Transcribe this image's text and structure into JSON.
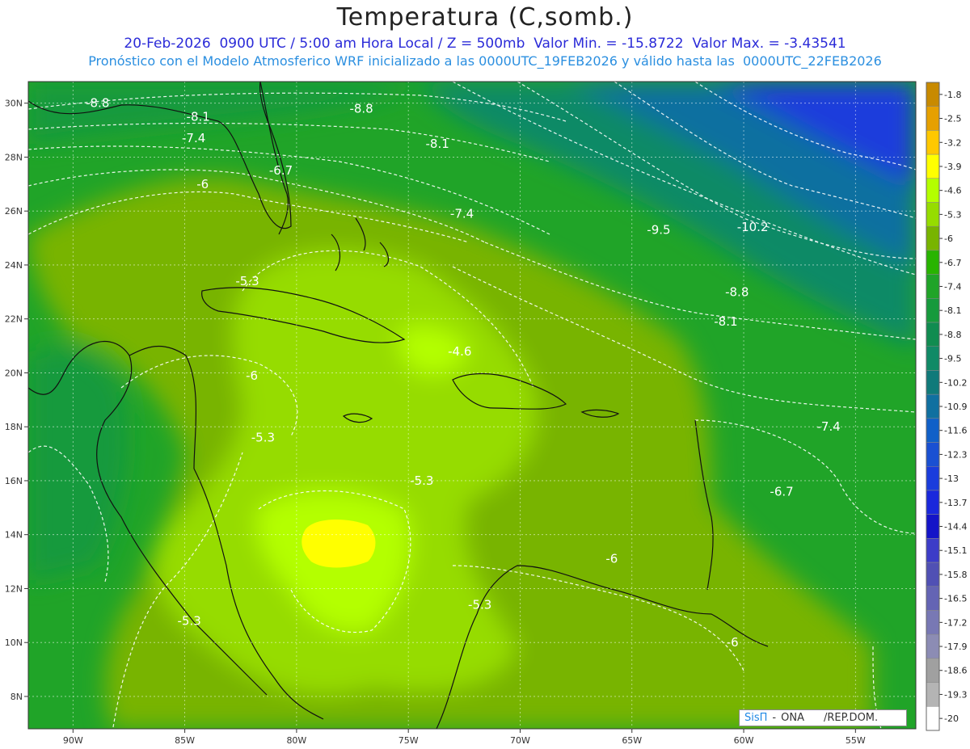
{
  "title": "Temperatura (C,somb.)",
  "subtitle_1": "20-Feb-2026  0900 UTC / 5:00 am Hora Local / Z = 500mb  Valor Min. = -15.8722  Valor Max. = -3.43541",
  "subtitle_2": "Pronóstico con el Modelo Atmosferico WRF inicializado a las 0000UTC_19FEB2026 y válido hasta las  0000UTC_22FEB2026",
  "lat_ticks": [
    "30N",
    "28N",
    "26N",
    "24N",
    "22N",
    "20N",
    "18N",
    "16N",
    "14N",
    "12N",
    "10N",
    "8N"
  ],
  "lon_ticks": [
    "90W",
    "85W",
    "80W",
    "75W",
    "70W",
    "65W",
    "60W",
    "55W"
  ],
  "legend": {
    "labels": [
      "-1.8",
      "-2.5",
      "-3.2",
      "-3.9",
      "-4.6",
      "-5.3",
      "-6",
      "-6.7",
      "-7.4",
      "-8.1",
      "-8.8",
      "-9.5",
      "-10.2",
      "-10.9",
      "-11.6",
      "-12.3",
      "-13",
      "-13.7",
      "-14.4",
      "-15.1",
      "-15.8",
      "-16.5",
      "-17.2",
      "-17.9",
      "-18.6",
      "-19.3",
      "-20"
    ],
    "colors": [
      "#c88a00",
      "#e6a000",
      "#ffc800",
      "#ffff00",
      "#b4ff00",
      "#96dc00",
      "#78b400",
      "#28b400",
      "#20a428",
      "#169a3c",
      "#108c50",
      "#108a66",
      "#107a7a",
      "#1070a0",
      "#1060c8",
      "#1a50d2",
      "#1a3cdc",
      "#1a28dc",
      "#1414c8",
      "#3c3cc8",
      "#5050b4",
      "#6464b4",
      "#7878b4",
      "#8c8cb4",
      "#a0a0a0",
      "#b4b4b4",
      "#ffffff"
    ]
  },
  "contour_labels": [
    {
      "text": "-8.8",
      "lon": -88.9,
      "lat": 30.0
    },
    {
      "text": "-8.1",
      "lon": -84.4,
      "lat": 29.5
    },
    {
      "text": "-7.4",
      "lon": -84.6,
      "lat": 28.7
    },
    {
      "text": "-6",
      "lon": -84.2,
      "lat": 27.0
    },
    {
      "text": "-6.7",
      "lon": -80.7,
      "lat": 27.5
    },
    {
      "text": "-8.8",
      "lon": -77.1,
      "lat": 29.8
    },
    {
      "text": "-8.1",
      "lon": -73.7,
      "lat": 28.5
    },
    {
      "text": "-7.4",
      "lon": -72.6,
      "lat": 25.9
    },
    {
      "text": "-9.5",
      "lon": -63.8,
      "lat": 25.3
    },
    {
      "text": "-10.2",
      "lon": -59.6,
      "lat": 25.4
    },
    {
      "text": "-8.8",
      "lon": -60.3,
      "lat": 23.0
    },
    {
      "text": "-8.1",
      "lon": -60.8,
      "lat": 21.9
    },
    {
      "text": "-7.4",
      "lon": -56.2,
      "lat": 18.0
    },
    {
      "text": "-6.7",
      "lon": -58.3,
      "lat": 15.6
    },
    {
      "text": "-5.3",
      "lon": -82.2,
      "lat": 23.4
    },
    {
      "text": "-4.6",
      "lon": -72.7,
      "lat": 20.8
    },
    {
      "text": "-6",
      "lon": -82.0,
      "lat": 19.9
    },
    {
      "text": "-5.3",
      "lon": -81.5,
      "lat": 17.6
    },
    {
      "text": "-5.3",
      "lon": -74.4,
      "lat": 16.0
    },
    {
      "text": "-6",
      "lon": -65.9,
      "lat": 13.1
    },
    {
      "text": "-5.3",
      "lon": -71.8,
      "lat": 11.4
    },
    {
      "text": "-5.3",
      "lon": -84.8,
      "lat": 10.8
    },
    {
      "text": "-6",
      "lon": -60.5,
      "lat": 10.0
    }
  ],
  "credit": {
    "brand": "SisΠ",
    "sep": "-",
    "org": "ONA",
    "region": "/REP.DOM."
  }
}
